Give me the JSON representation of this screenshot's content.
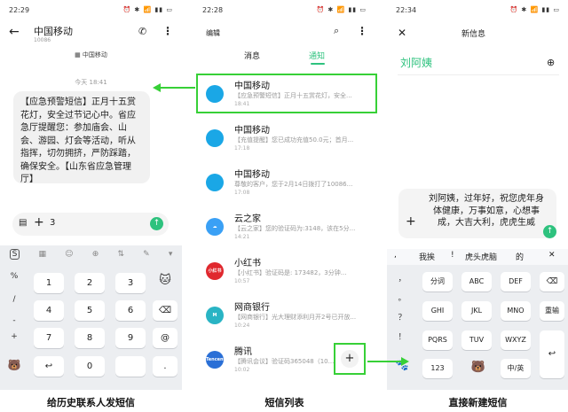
{
  "panel1": {
    "status": {
      "time": "22:29",
      "icons": "⏰ ✱ 📶 ▮▮ ▭"
    },
    "header": {
      "back": "←",
      "name": "中国移动",
      "number": "10086",
      "phone": "✆",
      "more": "⋮"
    },
    "sim_label": "▦ 中国移动",
    "date": "今天 18:41",
    "message": "【应急预警短信】正月十五赏花灯，安全过节记心中。省应急厅提醒您：参加庙会、山会、游园、灯会等活动，听从指挥，切勿拥挤，严防踩踏，确保安全。【山东省应急管理厅】",
    "input": {
      "keyboard_icon": "▤",
      "plus": "+",
      "text": "3",
      "send": "↑"
    },
    "toolbar": [
      "S",
      "▦",
      "☺",
      "⊕",
      "⇅",
      "✎",
      "▾"
    ],
    "side_keys": [
      "%",
      "/",
      "-",
      "+"
    ],
    "keys": [
      "1",
      "2",
      "3",
      "4",
      "5",
      "6",
      "7",
      "8",
      "9",
      "0",
      "@",
      "↩",
      "",
      "⌫",
      "."
    ],
    "caption": "给历史联系人发短信"
  },
  "panel2": {
    "status": {
      "time": "22:28",
      "icons": "⏰ ✱ 📶 ▮▮ ▭"
    },
    "edit": "编辑",
    "tabs": {
      "messages": "消息",
      "notifications": "通知"
    },
    "rows": [
      {
        "name": "中国移动",
        "preview": "【应急预警短信】正月十五赏花灯，安全...",
        "time": "18:41",
        "avatar": "",
        "color": "#1aa7e6"
      },
      {
        "name": "中国移动",
        "preview": "【充值提醒】您已成功充值50.0元；首月...",
        "time": "17:18",
        "avatar": "",
        "color": "#1aa7e6"
      },
      {
        "name": "中国移动",
        "preview": "尊敬的客户，您于2月14日拨打了10086...",
        "time": "17:08",
        "avatar": "",
        "color": "#1aa7e6"
      },
      {
        "name": "云之家",
        "preview": "【云之家】您的验证码为:3148，该在5分...",
        "time": "14:21",
        "avatar": "☁",
        "color": "#3aa0f5"
      },
      {
        "name": "小红书",
        "preview": "【小红书】验证码是: 173482，3分钟...",
        "time": "10:57",
        "avatar": "小红书",
        "color": "#e0282e"
      },
      {
        "name": "网商银行",
        "preview": "【网商银行】光大理财添利月开2号已开放...",
        "time": "10:24",
        "avatar": "M",
        "color": "#29b4c4"
      },
      {
        "name": "腾讯",
        "preview": "【腾讯会议】验证码365048（10...",
        "time": "10:02",
        "avatar": "Tencent腾讯",
        "color": "#2a6fd6"
      }
    ],
    "fab": "+",
    "caption": "短信列表"
  },
  "panel3": {
    "status": {
      "time": "22:34",
      "icons": "⏰ ✱ 📶 ▮▮ ▭"
    },
    "close": "✕",
    "title": "新信息",
    "recipient": "刘阿姨",
    "add_contact": "⊕",
    "message": "刘阿姨，过年好，祝您虎年身体健康，万事如意，心想事成，大吉大利，虎虎生威",
    "plus": "+",
    "send": "↑",
    "candidates": [
      ",",
      "我挨",
      "!",
      "虎头虎脑",
      "的"
    ],
    "cand_close": "✕",
    "side_keys": [
      "，",
      "。",
      "？",
      "！"
    ],
    "keys": [
      "分词",
      "ABC",
      "DEF",
      "GHI",
      "JKL",
      "MNO",
      "PQRS",
      "TUV",
      "WXYZ",
      "123",
      "中/英",
      "⌫",
      "重输",
      "↩"
    ],
    "caption": "直接新建短信"
  }
}
